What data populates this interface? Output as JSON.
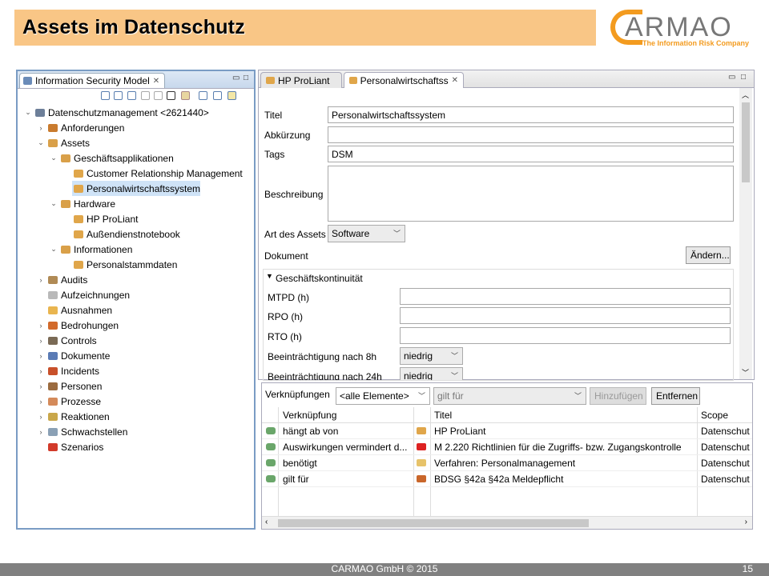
{
  "slide": {
    "title": "Assets im Datenschutz",
    "logo_word": "ARMAO",
    "logo_tagline": "The Information Risk Company",
    "footer_text": "CARMAO GmbH © 2015",
    "page_number": "15",
    "colors": {
      "title_bg": "#f9c686",
      "brand": "#f39b1f"
    }
  },
  "left_panel": {
    "tab_label": "Information Security Model",
    "tree": [
      {
        "label": "Datenschutzmanagement <2621440>",
        "level": 0,
        "expander": "open",
        "icon": "model-icon"
      },
      {
        "label": "Anforderungen",
        "level": 1,
        "expander": "closed",
        "icon": "requirements-icon"
      },
      {
        "label": "Assets",
        "level": 1,
        "expander": "open",
        "icon": "folder-icon"
      },
      {
        "label": "Geschäftsapplikationen",
        "level": 2,
        "expander": "open",
        "icon": "folder-icon"
      },
      {
        "label": "Customer Relationship Management",
        "level": 3,
        "expander": "none",
        "icon": "asset-icon"
      },
      {
        "label": "Personalwirtschaftssystem",
        "level": 3,
        "expander": "none",
        "icon": "asset-icon",
        "selected": true
      },
      {
        "label": "Hardware",
        "level": 2,
        "expander": "open",
        "icon": "folder-icon"
      },
      {
        "label": "HP ProLiant",
        "level": 3,
        "expander": "none",
        "icon": "asset-icon"
      },
      {
        "label": "Außendienstnotebook",
        "level": 3,
        "expander": "none",
        "icon": "asset-icon"
      },
      {
        "label": "Informationen",
        "level": 2,
        "expander": "open",
        "icon": "folder-icon"
      },
      {
        "label": "Personalstammdaten",
        "level": 3,
        "expander": "none",
        "icon": "asset-icon"
      },
      {
        "label": "Audits",
        "level": 1,
        "expander": "closed",
        "icon": "audit-icon"
      },
      {
        "label": "Aufzeichnungen",
        "level": 1,
        "expander": "none",
        "icon": "records-icon"
      },
      {
        "label": "Ausnahmen",
        "level": 1,
        "expander": "none",
        "icon": "exceptions-icon"
      },
      {
        "label": "Bedrohungen",
        "level": 1,
        "expander": "closed",
        "icon": "threat-icon"
      },
      {
        "label": "Controls",
        "level": 1,
        "expander": "closed",
        "icon": "control-icon"
      },
      {
        "label": "Dokumente",
        "level": 1,
        "expander": "closed",
        "icon": "document-icon"
      },
      {
        "label": "Incidents",
        "level": 1,
        "expander": "closed",
        "icon": "incident-icon"
      },
      {
        "label": "Personen",
        "level": 1,
        "expander": "closed",
        "icon": "person-icon"
      },
      {
        "label": "Prozesse",
        "level": 1,
        "expander": "closed",
        "icon": "process-icon"
      },
      {
        "label": "Reaktionen",
        "level": 1,
        "expander": "closed",
        "icon": "response-icon"
      },
      {
        "label": "Schwachstellen",
        "level": 1,
        "expander": "closed",
        "icon": "vulnerability-icon"
      },
      {
        "label": "Szenarios",
        "level": 1,
        "expander": "none",
        "icon": "scenario-icon"
      }
    ]
  },
  "editor": {
    "tabs": [
      {
        "label": "HP ProLiant",
        "active": false
      },
      {
        "label": "Personalwirtschaftss",
        "active": true
      }
    ],
    "fields": {
      "titel_label": "Titel",
      "titel_value": "Personalwirtschaftssystem",
      "abk_label": "Abkürzung",
      "abk_value": "",
      "tags_label": "Tags",
      "tags_value": "DSM",
      "beschreibung_label": "Beschreibung",
      "beschreibung_value": "",
      "art_label": "Art des Assets",
      "art_value": "Software",
      "dokument_label": "Dokument",
      "aendern_label": "Ändern..."
    },
    "section": {
      "title": "Geschäftskontinuität",
      "mtpd_label": "MTPD (h)",
      "rpo_label": "RPO (h)",
      "rto_label": "RTO (h)",
      "b8_label": "Beeinträchtigung nach 8h",
      "b8_value": "niedrig",
      "b24_label": "Beeinträchtigung nach 24h",
      "b24_value": "niedrig"
    }
  },
  "links": {
    "label": "Verknüpfungen",
    "filter_value": "<alle Elemente>",
    "relation_value": "gilt für",
    "add_label": "Hinzufügen",
    "remove_label": "Entfernen",
    "headers": [
      "Verknüpfung",
      "Titel",
      "Scope"
    ],
    "rows": [
      {
        "link": "hängt ab von",
        "title": "HP ProLiant",
        "scope": "Datenschut",
        "type_icon": "asset-icon"
      },
      {
        "link": "Auswirkungen vermindert d...",
        "title": "M 2.220 Richtlinien für die Zugriffs- bzw. Zugangskontrolle",
        "scope": "Datenschut",
        "type_icon": "measure-red-x-icon"
      },
      {
        "link": "benötigt",
        "title": "Verfahren: Personalmanagement",
        "scope": "Datenschut",
        "type_icon": "procedure-icon"
      },
      {
        "link": "gilt für",
        "title": "BDSG §42a §42a Meldepflicht",
        "scope": "Datenschut",
        "type_icon": "law-icon"
      }
    ]
  }
}
